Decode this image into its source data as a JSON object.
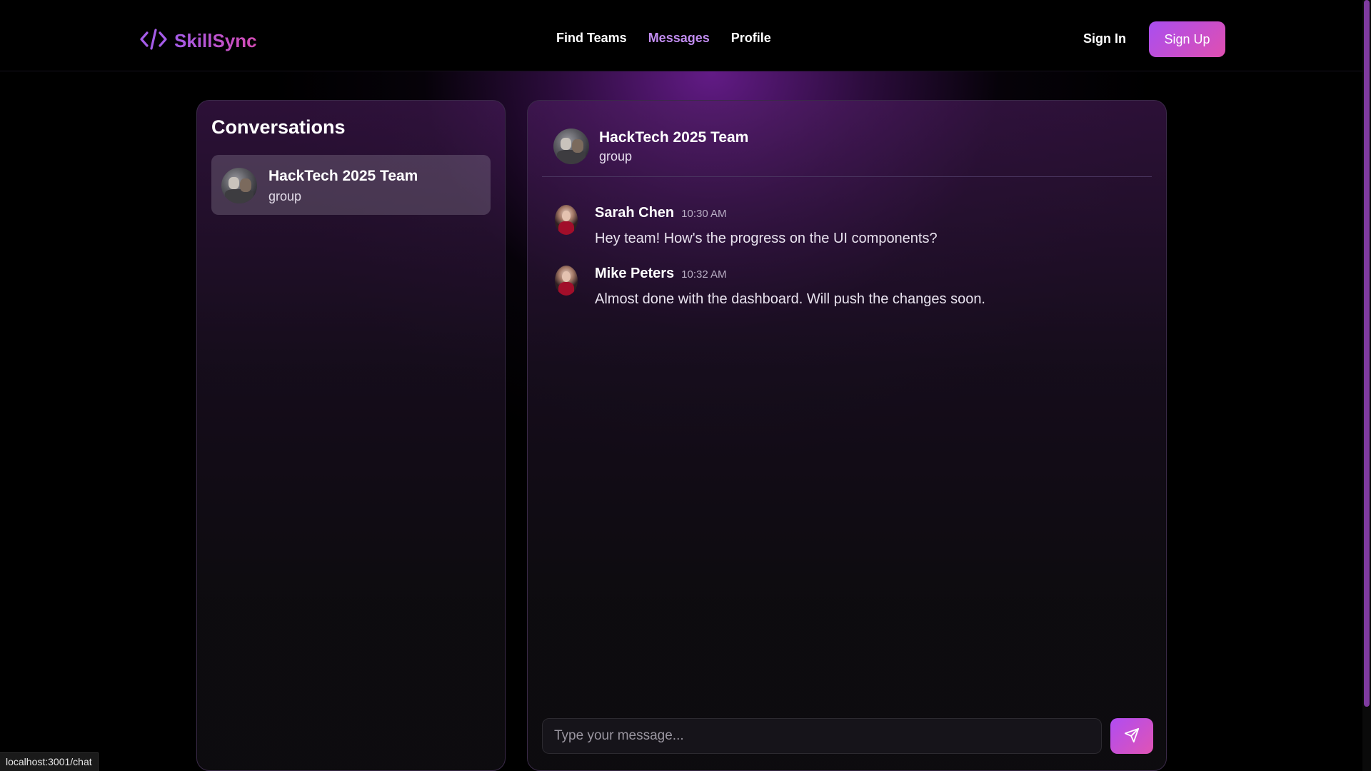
{
  "brand": {
    "name": "SkillSync",
    "icon": "code-icon"
  },
  "nav": {
    "links": [
      {
        "label": "Find Teams",
        "active": false
      },
      {
        "label": "Messages",
        "active": true
      },
      {
        "label": "Profile",
        "active": false
      }
    ],
    "sign_in": "Sign In",
    "sign_up": "Sign Up"
  },
  "conversations": {
    "title": "Conversations",
    "items": [
      {
        "name": "HackTech 2025 Team",
        "type": "group"
      }
    ]
  },
  "chat": {
    "name": "HackTech 2025 Team",
    "type": "group",
    "messages": [
      {
        "sender": "Sarah Chen",
        "time": "10:30 AM",
        "text": "Hey team! How's the progress on the UI components?"
      },
      {
        "sender": "Mike Peters",
        "time": "10:32 AM",
        "text": "Almost done with the dashboard. Will push the changes soon."
      }
    ],
    "composer_placeholder": "Type your message...",
    "send_icon": "send-icon"
  },
  "status_bar": {
    "url": "localhost:3001/chat"
  },
  "colors": {
    "accent": "#a94ef0",
    "accent2": "#e04fb0",
    "active_link": "#c18cf0"
  }
}
